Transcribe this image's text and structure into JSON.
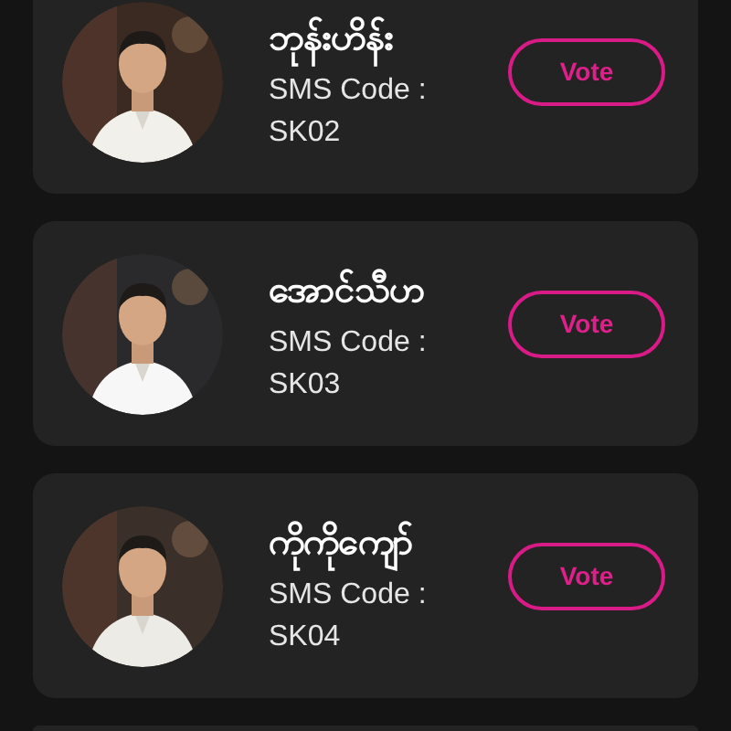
{
  "candidates": [
    {
      "name": "ဘုန်းဟိန်း",
      "code_label": "SMS Code :",
      "code": "SK02",
      "button": "Vote"
    },
    {
      "name": "အောင်သီဟ",
      "code_label": "SMS Code :",
      "code": "SK03",
      "button": "Vote"
    },
    {
      "name": "ကိုကိုကျော်",
      "code_label": "SMS Code :",
      "code": "SK04",
      "button": "Vote"
    }
  ]
}
